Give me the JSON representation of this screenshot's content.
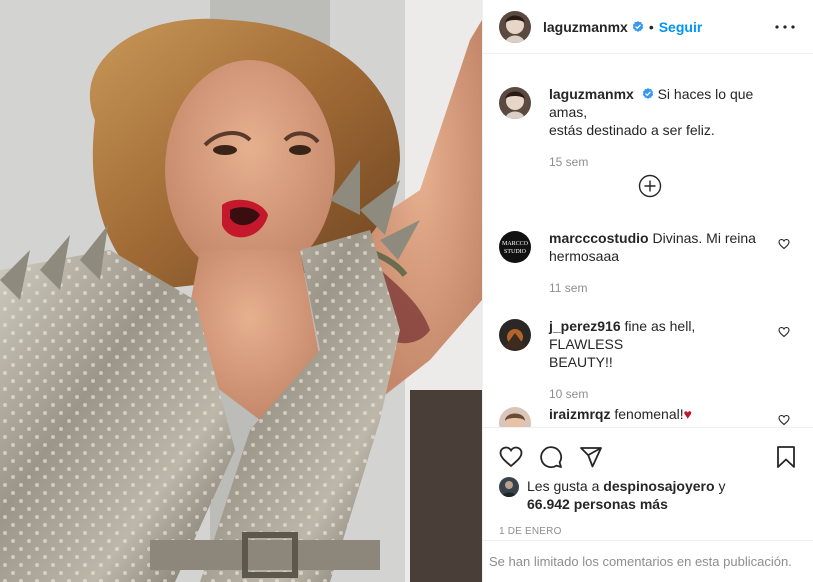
{
  "post": {
    "image_alt": "Mujer con chaqueta plateada con tachas y pelo rizado",
    "author": "laguzmanmx",
    "verified": true,
    "separator": "•",
    "follow_label": "Seguir",
    "more_icon": "more-horizontal-icon"
  },
  "caption": {
    "author": "laguzmanmx",
    "text_line1": "Si haces lo que amas,",
    "text_line2": "estás destinado a ser feliz.",
    "time": "15 sem"
  },
  "load_more_icon": "circle-plus-icon",
  "comments": [
    {
      "author": "marcccostudio",
      "text_line1": "Divinas. Mi reina",
      "text_line2": "hermosaaa",
      "time": "11 sem",
      "avatar_text": "MARCCO STUDIO"
    },
    {
      "author": "j_perez916",
      "text_line1": "fine as hell, FLAWLESS",
      "text_line2": "BEAUTY!!",
      "time": "10 sem"
    },
    {
      "author": "iraizmrqz",
      "text_line1": "fenomenal!♥",
      "text_line2": "",
      "time": ""
    }
  ],
  "actions": {
    "like_icon": "heart-icon",
    "comment_icon": "comment-icon",
    "share_icon": "send-icon",
    "save_icon": "bookmark-icon"
  },
  "likes": {
    "prefix": "Les gusta a",
    "user": "despinosajoyero",
    "joiner": "y",
    "count": "66.942 personas más"
  },
  "date": "1 DE ENERO",
  "limited_notice": "Se han limitado los comentarios en esta publicación.",
  "colors": {
    "accent": "#0095f6",
    "muted": "#8e8e8e",
    "text": "#262626",
    "heart_emoji": "#c0152a"
  }
}
